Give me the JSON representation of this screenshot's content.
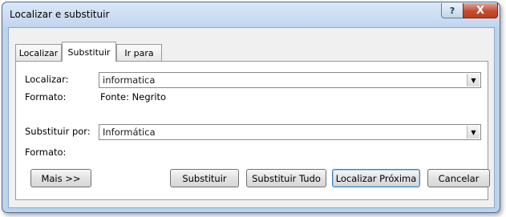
{
  "window": {
    "title": "Localizar e substituir",
    "help_label": "?",
    "close_label": "X"
  },
  "tabs": [
    {
      "label": "Localizar",
      "active": false
    },
    {
      "label": "Substituir",
      "active": true
    },
    {
      "label": "Ir para",
      "active": false
    }
  ],
  "find": {
    "label": "Localizar:",
    "value": "informatica",
    "format_label": "Formato:",
    "format_value": "Fonte: Negrito"
  },
  "replace": {
    "label": "Substituir por:",
    "value": "Informática",
    "format_label": "Formato:"
  },
  "buttons": {
    "more": "Mais >>",
    "replace": "Substituir",
    "replace_all": "Substituir Tudo",
    "find_next": "Localizar Próxima",
    "cancel": "Cancelar"
  },
  "icons": {
    "dropdown": "chevron-down-icon",
    "help": "help-icon",
    "close": "close-icon"
  }
}
